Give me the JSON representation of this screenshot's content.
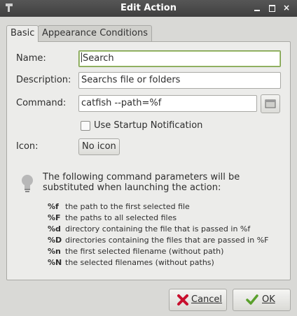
{
  "window": {
    "title": "Edit Action",
    "buttons": {
      "minimize": "minimize",
      "maximize": "maximize",
      "close": "×"
    }
  },
  "tabs": [
    {
      "label": "Basic",
      "active": true
    },
    {
      "label": "Appearance Conditions",
      "active": false
    }
  ],
  "form": {
    "name_label": "Name:",
    "name_value": "Search",
    "description_label": "Description:",
    "description_value": "Searchs file or folders",
    "command_label": "Command:",
    "command_value": "catfish --path=%f",
    "startup_label": "Use Startup Notification",
    "startup_checked": false,
    "icon_label": "Icon:",
    "icon_button": "No icon"
  },
  "hint": {
    "text": "The following command parameters will be substituted when launching the action:",
    "params": [
      {
        "code": "%f",
        "desc": "the path to the first selected file"
      },
      {
        "code": "%F",
        "desc": "the paths to all selected files"
      },
      {
        "code": "%d",
        "desc": "directory containing the file that is passed in %f"
      },
      {
        "code": "%D",
        "desc": "directories containing the files that are passed in %F"
      },
      {
        "code": "%n",
        "desc": "the first selected filename (without path)"
      },
      {
        "code": "%N",
        "desc": "the selected filenames (without paths)"
      }
    ]
  },
  "buttons": {
    "cancel": "Cancel",
    "ok": "OK"
  },
  "colors": {
    "titlebar": "#474747",
    "focus_border": "#7c9e4a",
    "cancel_icon": "#c8102e",
    "ok_icon": "#5aa02c",
    "bulb": "#b8b8b8"
  }
}
